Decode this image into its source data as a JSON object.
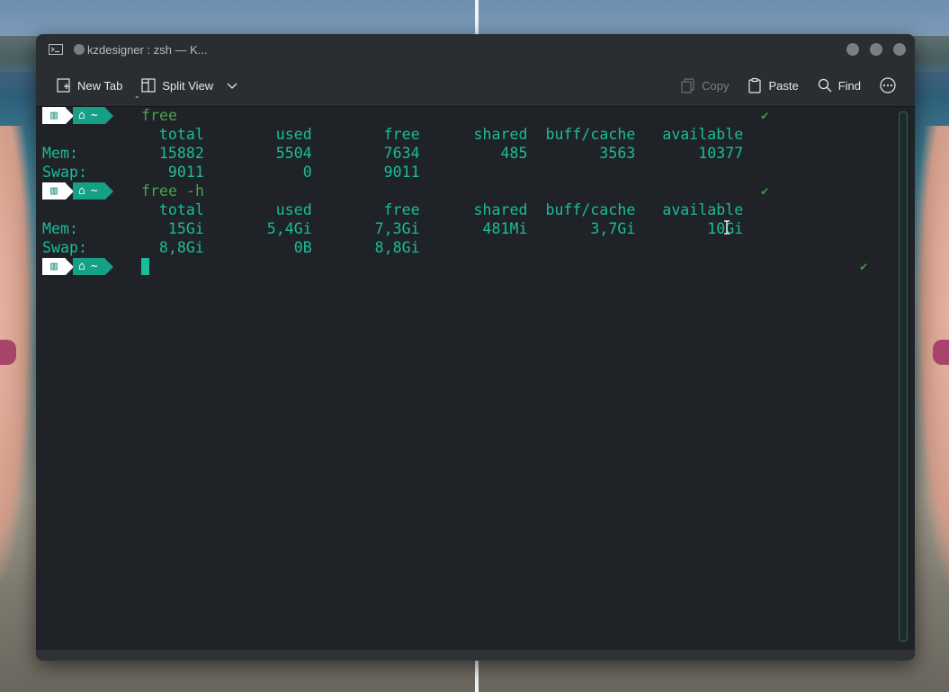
{
  "window": {
    "title": "kzdesigner : zsh — K...",
    "icon": "terminal-icon"
  },
  "toolbar": {
    "new_tab": "New Tab",
    "split_view": "Split View",
    "copy": "Copy",
    "paste": "Paste",
    "find": "Find"
  },
  "terminal": {
    "prompt_home": "~",
    "commands": [
      "free",
      "free -h"
    ],
    "free_header": "             total        used        free      shared  buff/cache   available",
    "free_mem": "Mem:         15882        5504        7634         485        3563       10377",
    "free_swap": "Swap:         9011           0        9011",
    "freeh_header": "             total        used        free      shared  buff/cache   available",
    "freeh_mem": "Mem:          15Gi       5,4Gi       7,3Gi       481Mi       3,7Gi        10Gi",
    "freeh_swap": "Swap:        8,8Gi          0B       8,8Gi",
    "check": "✔"
  },
  "colors": {
    "terminal_text": "#1abc9c",
    "command_text": "#4ba34b",
    "prompt_segment": "#16a085",
    "window_bg": "#1f2227"
  }
}
